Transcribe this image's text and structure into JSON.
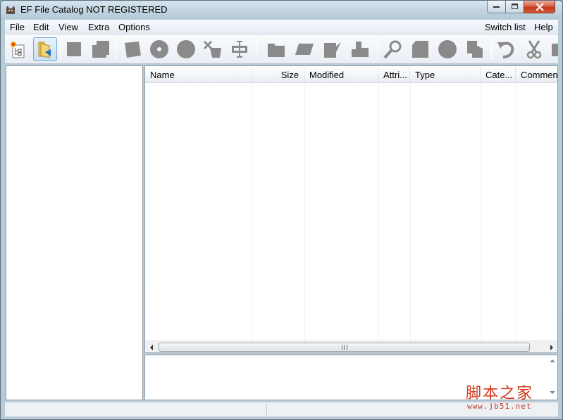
{
  "window": {
    "title": "EF File Catalog NOT REGISTERED"
  },
  "menubar": {
    "items": [
      "File",
      "Edit",
      "View",
      "Extra",
      "Options"
    ],
    "right_items": [
      "Switch list",
      "Help"
    ]
  },
  "toolbar": {
    "buttons": [
      {
        "icon": "new-catalog-icon"
      },
      {
        "icon": "open-folder-icon",
        "active": true
      },
      {
        "icon": "square-icon"
      },
      {
        "icon": "copy-pages-icon"
      },
      {
        "icon": "add-disk-icon"
      },
      {
        "icon": "cd-icon"
      },
      {
        "icon": "circle-icon"
      },
      {
        "icon": "delete-icon"
      },
      {
        "icon": "properties-icon"
      },
      {
        "icon": "folder-icon"
      },
      {
        "icon": "rename-icon"
      },
      {
        "icon": "edit-icon"
      },
      {
        "icon": "puzzle-icon"
      },
      {
        "icon": "search-icon"
      },
      {
        "icon": "page-icon"
      },
      {
        "icon": "globe-icon"
      },
      {
        "icon": "copy-icon"
      },
      {
        "icon": "undo-icon"
      },
      {
        "icon": "cut-icon"
      }
    ]
  },
  "file_list": {
    "columns": [
      "Name",
      "Size",
      "Modified",
      "Attri...",
      "Type",
      "Cate...",
      "Commen"
    ]
  },
  "watermark": {
    "text_cn": "脚本之家",
    "url": "www.jb51.net"
  },
  "colors": {
    "accent": "#7aa7d1",
    "icon_gray": "#8a8a8a",
    "watermark": "#d03a1e"
  }
}
